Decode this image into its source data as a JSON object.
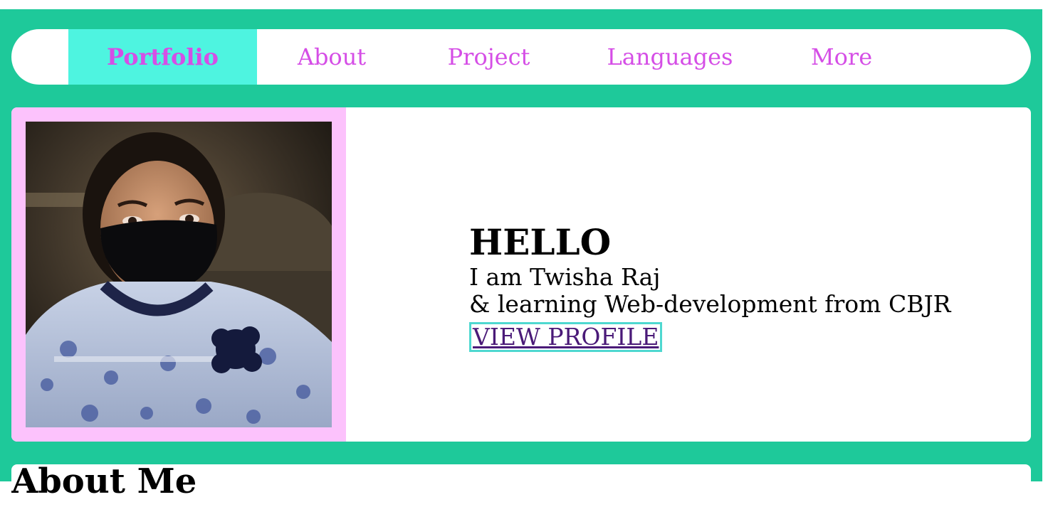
{
  "nav": {
    "items": [
      {
        "label": "Portfolio",
        "active": true
      },
      {
        "label": "About"
      },
      {
        "label": "Project"
      },
      {
        "label": "Languages"
      },
      {
        "label": "More"
      }
    ]
  },
  "hero": {
    "greeting": "HELLO",
    "line1": "I am Twisha Raj",
    "line2": "& learning Web-development from CBJR",
    "cta_label": "VIEW PROFILE"
  },
  "about": {
    "title": "About Me"
  },
  "colors": {
    "page_bg": "#1ec99a",
    "nav_text": "#d54ee6",
    "nav_active_bg": "#4ef4e0",
    "photo_frame": "#fcc2fc",
    "cta_border": "#4ed8d0",
    "cta_text": "#4a1a78"
  }
}
